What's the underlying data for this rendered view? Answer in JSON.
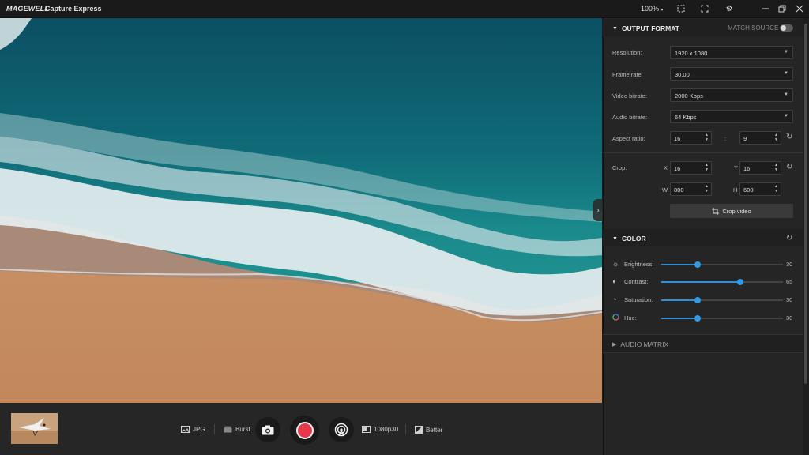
{
  "titlebar": {
    "logo": "MAGEWELL",
    "app_name": "Capture Express",
    "zoom": "100%"
  },
  "bottombar": {
    "format": "JPG",
    "burst": "Burst",
    "resolution": "1080p30",
    "quality": "Better"
  },
  "output_format": {
    "title": "OUTPUT FORMAT",
    "match_source": "MATCH SOURCE",
    "resolution_label": "Resolution:",
    "resolution": "1920 x 1080",
    "frame_rate_label": "Frame rate:",
    "frame_rate": "30.00",
    "video_bitrate_label": "Video bitrate:",
    "video_bitrate": "2000 Kbps",
    "audio_bitrate_label": "Audio bitrate:",
    "audio_bitrate": "64 Kbps",
    "aspect_label": "Aspect ratio:",
    "aspect_w": "16",
    "aspect_sep": ":",
    "aspect_h": "9",
    "crop_label": "Crop:",
    "crop_x_label": "X",
    "crop_x": "16",
    "crop_y_label": "Y",
    "crop_y": "16",
    "crop_w_label": "W",
    "crop_w": "800",
    "crop_h_label": "H",
    "crop_h": "600",
    "crop_button": "Crop video"
  },
  "color": {
    "title": "COLOR",
    "sliders": [
      {
        "icon": "brightness-icon",
        "label": "Brightness:",
        "value": 30
      },
      {
        "icon": "contrast-icon",
        "label": "Contrast:",
        "value": 65
      },
      {
        "icon": "saturation-icon",
        "label": "Saturation:",
        "value": 30
      },
      {
        "icon": "hue-icon",
        "label": "Hue:",
        "value": 30
      }
    ]
  },
  "audio_matrix": {
    "title": "AUDIO MATRIX"
  },
  "colors": {
    "accent": "#2f9be6",
    "record": "#e5384a"
  }
}
